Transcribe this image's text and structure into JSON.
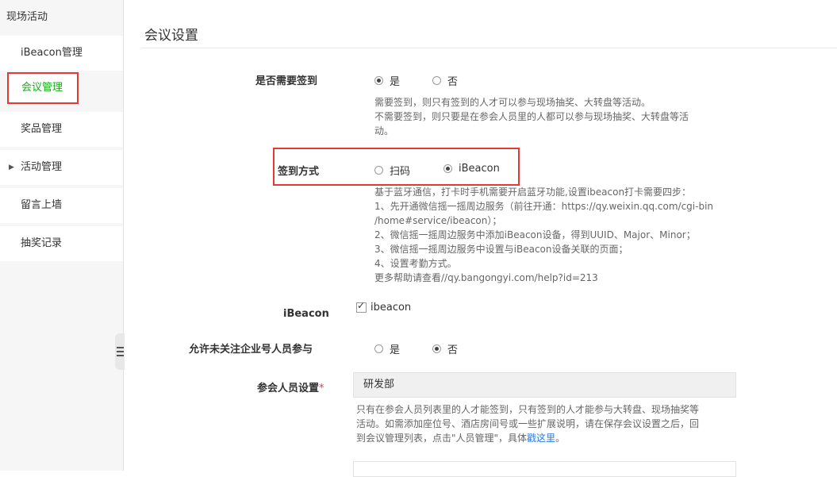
{
  "sidebar": {
    "title": "现场活动",
    "items": [
      {
        "label": "iBeacon管理"
      },
      {
        "label": "会议管理"
      },
      {
        "label": "奖品管理"
      },
      {
        "label": "活动管理"
      },
      {
        "label": "留言上墙"
      },
      {
        "label": "抽奖记录"
      }
    ]
  },
  "page": {
    "title": "会议设置"
  },
  "form": {
    "signin_required": {
      "label": "是否需要签到",
      "options": [
        "是",
        "否"
      ],
      "selected": "是",
      "help": [
        "需要签到，则只有签到的人才可以参与现场抽奖、大转盘等活动。",
        "不需要签到，则只要是在参会人员里的人都可以参与现场抽奖、大转盘等活",
        "动。"
      ]
    },
    "signin_method": {
      "label": "签到方式",
      "options": [
        "扫码",
        "iBeacon"
      ],
      "selected": "iBeacon",
      "help": [
        "基于蓝牙通信，打卡时手机需要开启蓝牙功能,设置ibeacon打卡需要四步：",
        "1、先开通微信摇一摇周边服务（前往开通：https://qy.weixin.qq.com/cgi-bin",
        "/home#service/ibeacon）；",
        "2、微信摇一摇周边服务中添加iBeacon设备，得到UUID、Major、Minor；",
        "3、微信摇一摇周边服务中设置与iBeacon设备关联的页面；",
        "4、设置考勤方式。",
        "更多帮助请查看//qy.bangongyi.com/help?id=213"
      ]
    },
    "ibeacon": {
      "label": "iBeacon",
      "checkbox_label": "ibeacon",
      "checked": true
    },
    "allow_unfollowed": {
      "label": "允许未关注企业号人员参与",
      "options": [
        "是",
        "否"
      ],
      "selected": "否"
    },
    "attendees": {
      "label": "参会人员设置",
      "required_mark": "*",
      "value": "研发部",
      "help_lines": [
        "只有在参会人员列表里的人才能签到，只有签到的人才能参与大转盘、现场抽奖等",
        "活动。如需添加座位号、酒店房间号或一些扩展说明，请在保存会议设置之后，回"
      ],
      "help_last_prefix": "到会议管理列表，点击\"人员管理\"，具体",
      "help_link": "戳这里",
      "help_last_suffix": "。"
    }
  },
  "colors": {
    "accent_green": "#1aad19",
    "highlight_red": "#e53935",
    "link_blue": "#2a7ae2"
  }
}
